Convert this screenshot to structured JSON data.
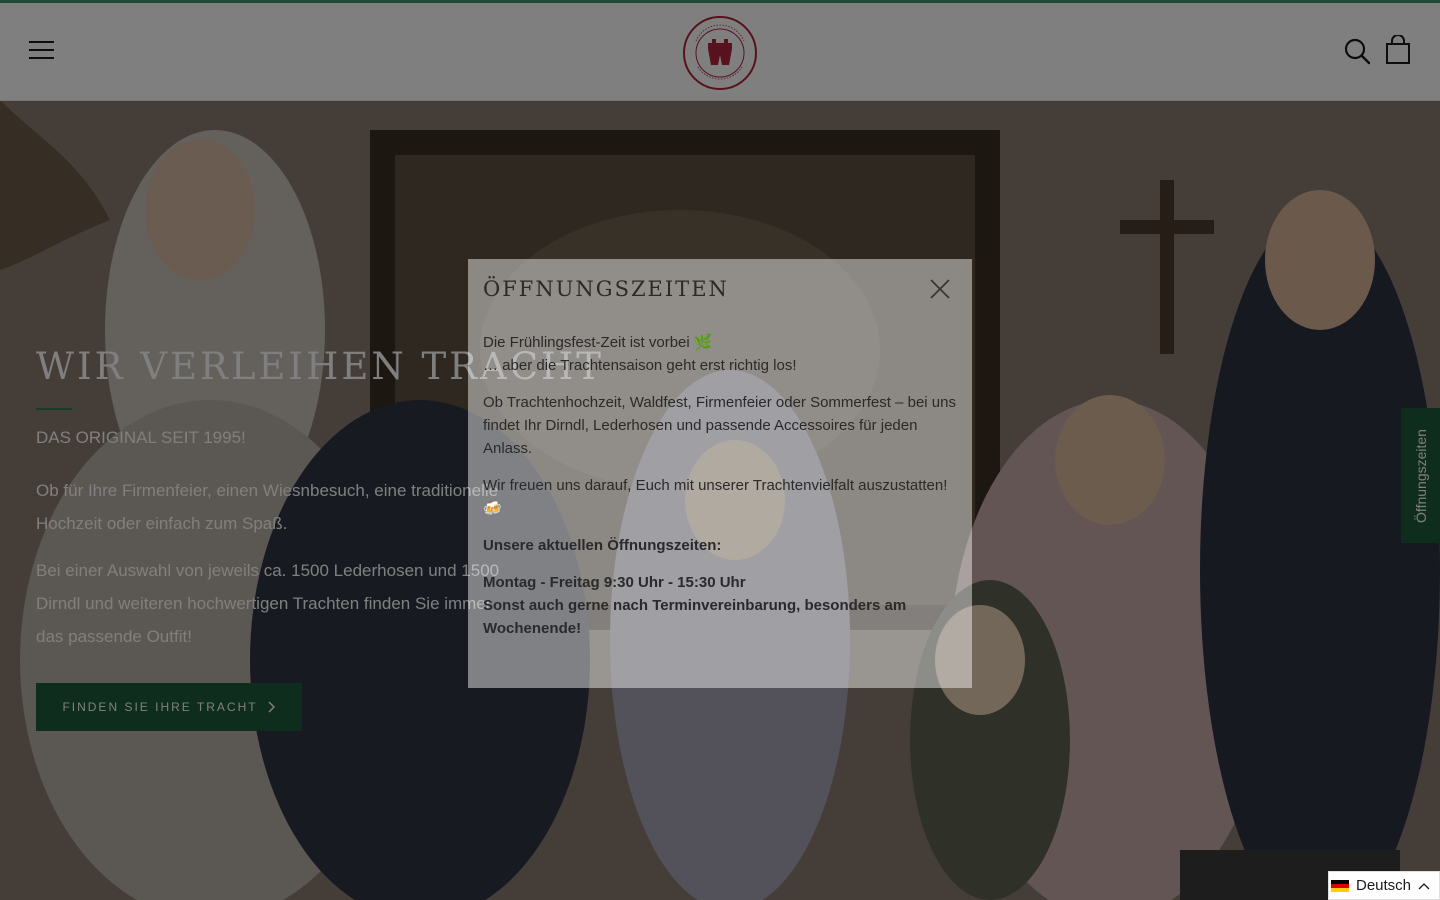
{
  "header": {
    "logo_text": "LEDERHOSENVERLEIH · RENT A LEDERHOSE",
    "menu_icon": "hamburger-menu-icon",
    "search_icon": "search-icon",
    "cart_icon": "shopping-bag-icon"
  },
  "hero": {
    "title": "WIR VERLEIHEN TRACHT",
    "subtitle": "DAS ORIGINAL SEIT 1995!",
    "paragraph1": "Ob für Ihre Firmenfeier, einen Wiesnbesuch, eine traditionelle Hochzeit oder einfach zum Spaß.",
    "paragraph2": "Bei einer Auswahl von jeweils ca. 1500 Lederhosen und 1500 Dirndl und weiteren hochwertigen Trachten finden Sie immer das passende Outfit!",
    "cta_label": "FINDEN SIE IHRE TRACHT",
    "cta_icon": "chevron-right-icon"
  },
  "side_tab": {
    "label": "Öffnungszeiten"
  },
  "modal": {
    "title": "ÖFFNUNGSZEITEN",
    "close_icon": "close-icon",
    "line1": "Die Frühlingsfest-Zeit ist vorbei 🌿",
    "line2": "… aber die Trachtensaison geht erst richtig los!",
    "paragraph2": "Ob Trachtenhochzeit, Waldfest, Firmenfeier oder Sommerfest – bei uns findet Ihr Dirndl, Lederhosen und passende Accessoires für jeden Anlass.",
    "paragraph3": "Wir freuen uns darauf, Euch mit unserer Trachtenvielfalt auszustatten! 🍻",
    "hours_heading": "Unsere aktuellen Öffnungszeiten:",
    "hours_line1": "Montag - Freitag 9:30 Uhr - 15:30 Uhr",
    "hours_line2": "Sonst auch gerne nach Terminvereinbarung, besonders am Wochenende!"
  },
  "language": {
    "label": "Deutsch",
    "flag_icon": "german-flag-icon",
    "chevron_icon": "chevron-up-icon"
  },
  "colors": {
    "brand_green": "#1e5a3a",
    "accent_green": "#2f7a50",
    "logo_red": "#b0253b"
  }
}
